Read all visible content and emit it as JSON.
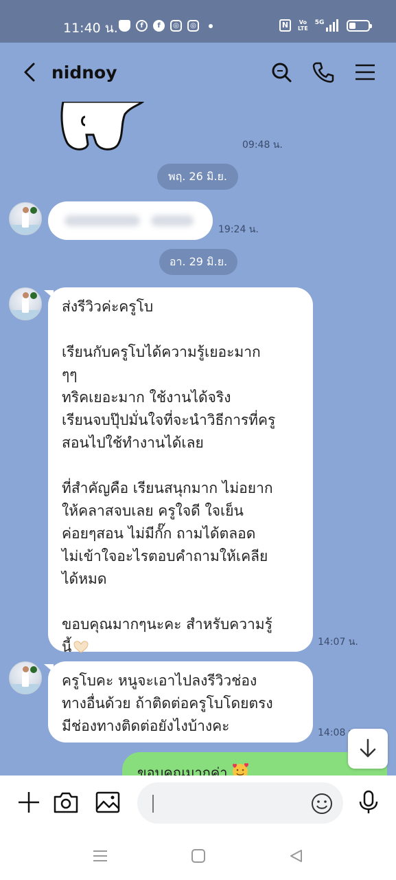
{
  "status_bar": {
    "time": "11:40 น.",
    "network": "5G",
    "volte": "Vo LTE",
    "nfc": "N"
  },
  "header": {
    "contact_name": "nidnoy"
  },
  "messages": {
    "sticker_time": "09:48 น.",
    "date_1": "พฤ. 26 มิ.ย.",
    "blurred_time": "19:24 น.",
    "date_2": "อา. 29 มิ.ย.",
    "review": {
      "lines": [
        "ส่งรีวิวค่ะครูโบ",
        "",
        "เรียนกับครูโบได้ความรู้เยอะมาก",
        "ๆๆ",
        "ทริคเยอะมาก ใช้งานได้จริง",
        "เรียนจบปุ๊ปมั่นใจที่จะนำวิธีการที่ครู",
        "สอนไปใช้ทำงานได้เลย",
        "",
        "ที่สำคัญคือ เรียนสนุกมาก ไม่อยาก",
        "ให้คลาสจบเลย ครูใจดี ใจเย็น",
        "ค่อยๆสอน ไม่มีกั๊ก ถามได้ตลอด",
        "ไม่เข้าใจอะไรตอบคำถามให้เคลีย",
        "ได้หมด",
        "",
        "ขอบคุณมากๆนะคะ สำหรับความรู้"
      ],
      "last_line": "นี้",
      "time": "14:07 น."
    },
    "question": {
      "lines": [
        "ครูโบคะ หนูจะเอาไปลงรีวิวช่อง",
        "ทางอื่นด้วย ถ้าติดต่อครูโบโดยตรง",
        "มีช่องทางติดต่อยังไงบ้างคะ"
      ],
      "time": "14:08 น."
    },
    "reply": "ขอบคุณมากค่า"
  },
  "input": {
    "value": "",
    "placeholder": ""
  },
  "colors": {
    "chat_background": "#8aa6d6",
    "status_bar": "#66799c",
    "outgoing_bubble": "#88dd7d",
    "incoming_bubble": "#ffffff"
  },
  "icons": [
    "back-icon",
    "search-icon",
    "phone-icon",
    "menu-icon",
    "plus-icon",
    "camera-icon",
    "image-icon",
    "emoji-icon",
    "mic-icon",
    "scroll-down-icon"
  ]
}
